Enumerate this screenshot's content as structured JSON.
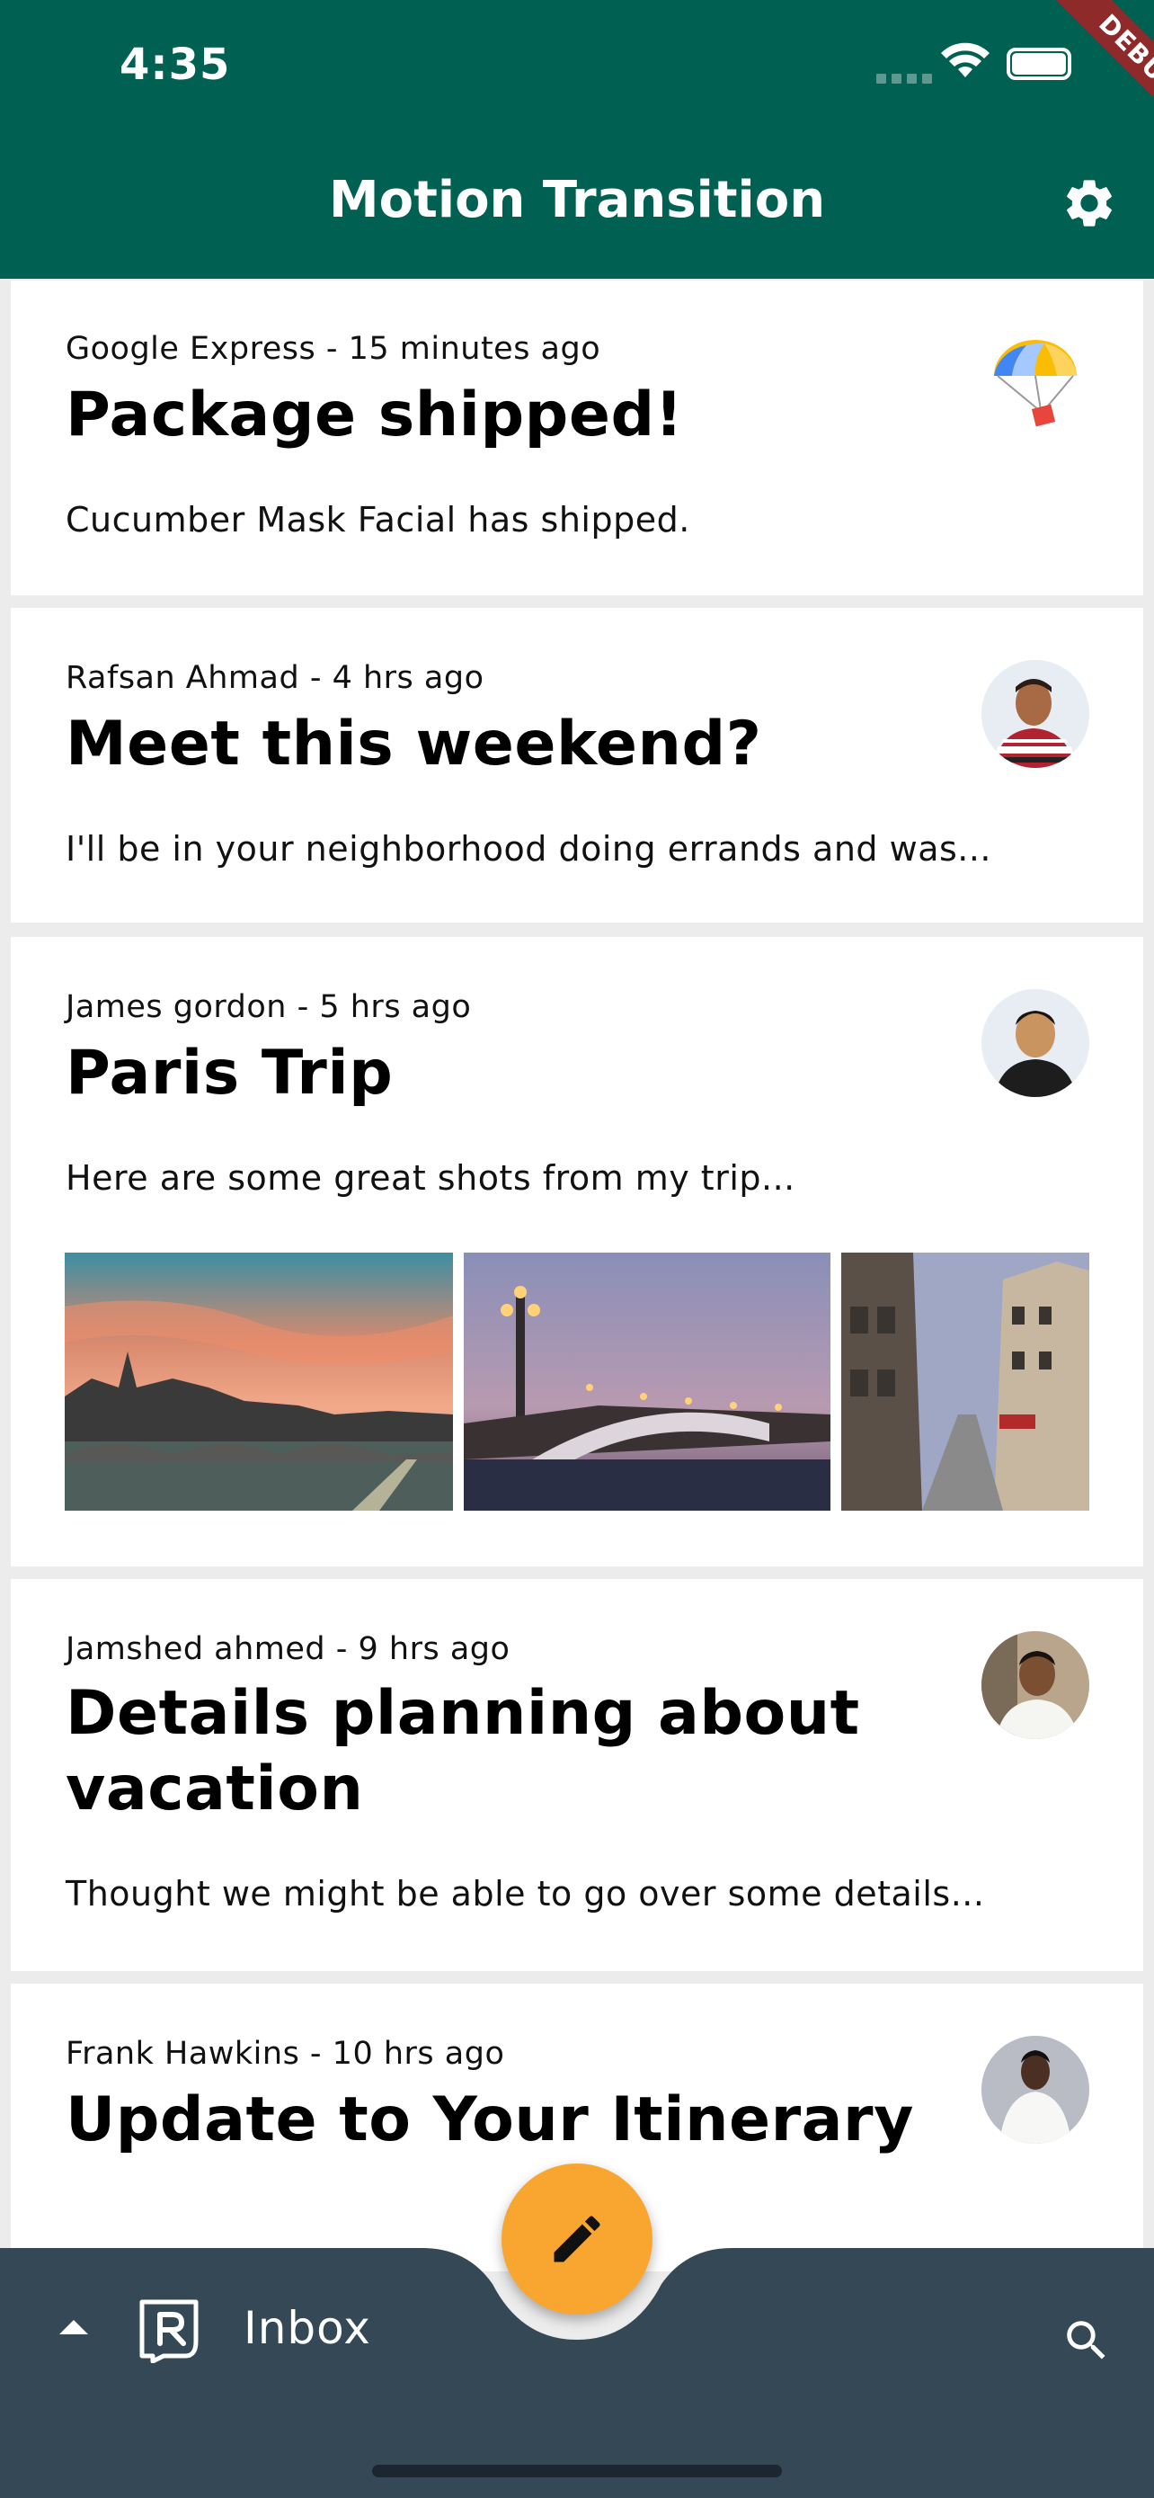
{
  "status_bar": {
    "time": "4:35",
    "debug_banner": "DEBUG"
  },
  "app_bar": {
    "title": "Motion Transition",
    "settings_icon": "gear-icon"
  },
  "emails": [
    {
      "meta": "Google Express - 15 minutes ago",
      "subject": "Package shipped!",
      "preview": "Cucumber Mask Facial has shipped.",
      "avatar": "parachute-logo"
    },
    {
      "meta": "Rafsan Ahmad - 4 hrs ago",
      "subject": "Meet this weekend?",
      "preview": "I'll be in your neighborhood doing errands and was...",
      "avatar": "person-avatar"
    },
    {
      "meta": "James gordon - 5 hrs ago",
      "subject": "Paris Trip",
      "preview": "Here are some great shots from my trip...",
      "avatar": "person-avatar",
      "attachments": [
        "paris-photo-sunset",
        "paris-photo-bridge",
        "paris-photo-street"
      ]
    },
    {
      "meta": "Jamshed ahmed - 9 hrs ago",
      "subject_line1": "Details planning about",
      "subject_line2": "vacation",
      "preview": "Thought we might be able to go over some details...",
      "avatar": "person-avatar"
    },
    {
      "meta": "Frank Hawkins - 10 hrs ago",
      "subject": "Update to Your Itinerary",
      "avatar": "person-avatar"
    }
  ],
  "bottom_bar": {
    "mailbox_label": "Inbox",
    "logo": "reply-logo-icon",
    "fab_icon": "pencil-icon",
    "search_icon": "search-icon",
    "colors": {
      "bar": "#344955",
      "fab": "#F9AA33"
    }
  },
  "colors": {
    "app_bar": "#006153",
    "card": "#FFFFFF",
    "background": "#ECECEC"
  }
}
